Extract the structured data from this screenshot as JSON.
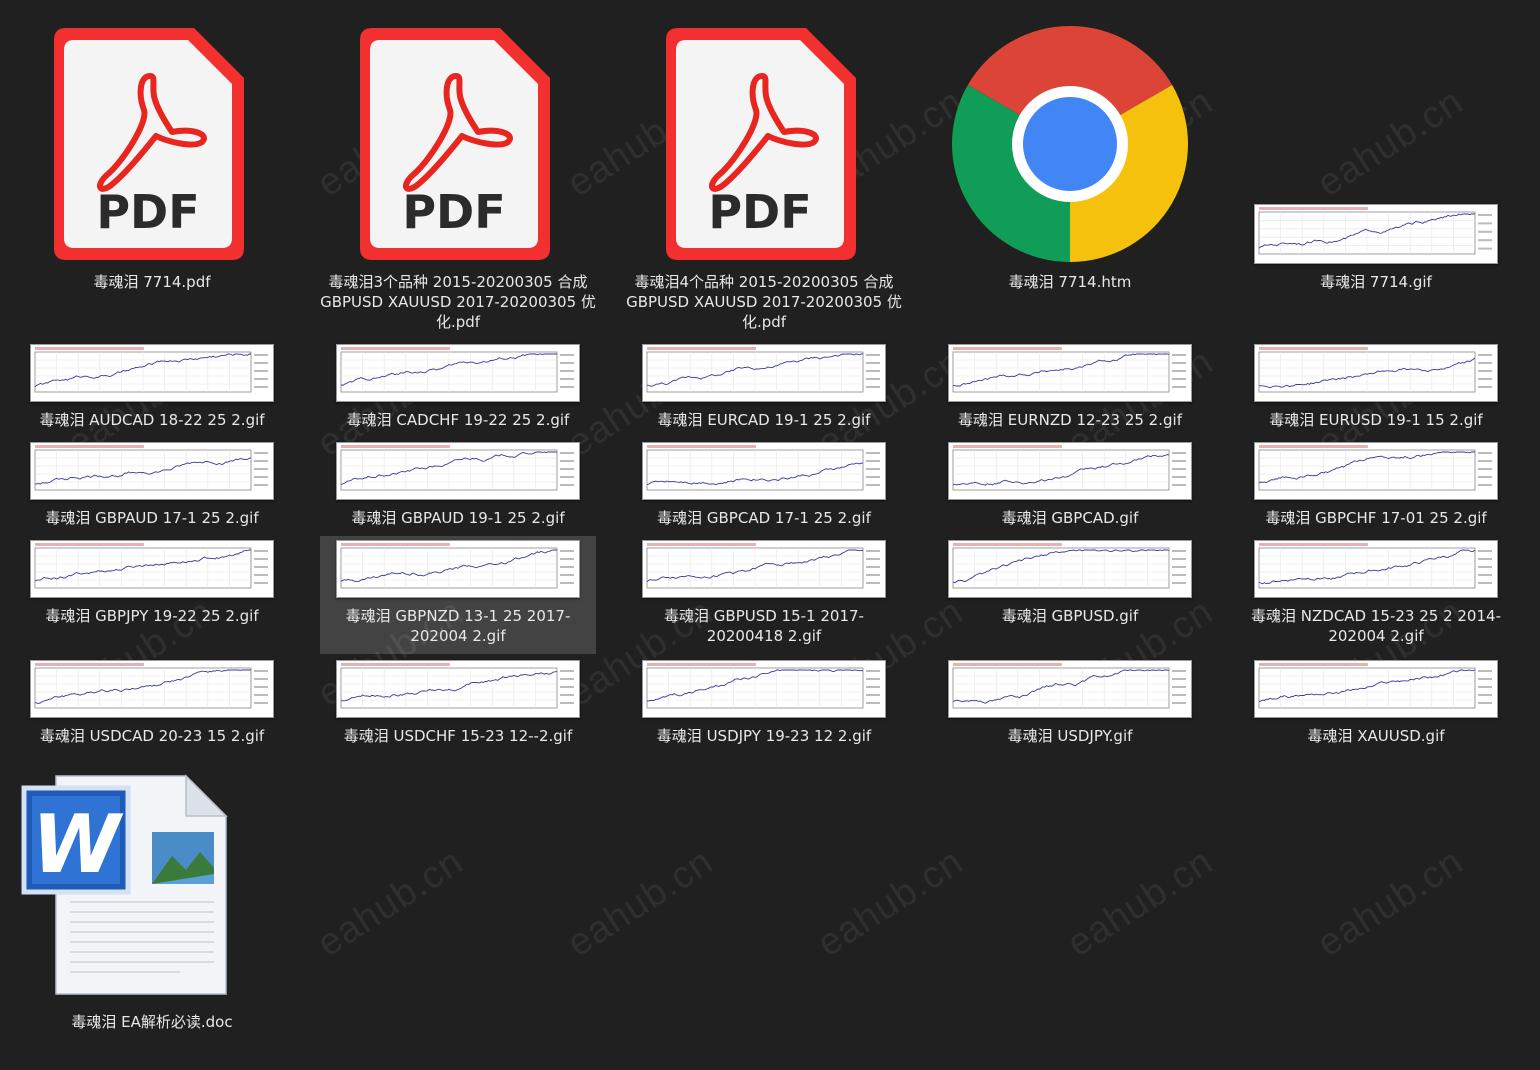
{
  "watermark": "eahub.cn",
  "files": [
    {
      "name": "毒魂泪 7714.pdf",
      "type": "pdf"
    },
    {
      "name": "毒魂泪3个品种 2015-20200305 合成 GBPUSD XAUUSD  2017-20200305 优化.pdf",
      "type": "pdf"
    },
    {
      "name": "毒魂泪4个品种 2015-20200305 合成 GBPUSD XAUUSD  2017-20200305 优化.pdf",
      "type": "pdf"
    },
    {
      "name": "毒魂泪 7714.htm",
      "type": "htm"
    },
    {
      "name": "毒魂泪 7714.gif",
      "type": "gif"
    },
    {
      "name": "毒魂泪 AUDCAD 18-22  25   2.gif",
      "type": "gif"
    },
    {
      "name": "毒魂泪 CADCHF  19-22 25    2.gif",
      "type": "gif"
    },
    {
      "name": "毒魂泪 EURCAD 19-1 25      2.gif",
      "type": "gif"
    },
    {
      "name": "毒魂泪 EURNZD 12-23  25  2.gif",
      "type": "gif"
    },
    {
      "name": "毒魂泪 EURUSD 19-1    15   2.gif",
      "type": "gif"
    },
    {
      "name": "毒魂泪 GBPAUD 17-1 25    2.gif",
      "type": "gif"
    },
    {
      "name": "毒魂泪 GBPAUD 19-1 25    2.gif",
      "type": "gif"
    },
    {
      "name": "毒魂泪 GBPCAD 17-1  25    2.gif",
      "type": "gif"
    },
    {
      "name": "毒魂泪 GBPCAD.gif",
      "type": "gif"
    },
    {
      "name": "毒魂泪 GBPCHF 17-01  25    2.gif",
      "type": "gif"
    },
    {
      "name": "毒魂泪 GBPJPY 19-22   25    2.gif",
      "type": "gif"
    },
    {
      "name": "毒魂泪 GBPNZD 13-1  25 2017-202004  2.gif",
      "type": "gif",
      "selected": true
    },
    {
      "name": "毒魂泪 GBPUSD  15-1 2017-20200418    2.gif",
      "type": "gif"
    },
    {
      "name": "毒魂泪 GBPUSD.gif",
      "type": "gif"
    },
    {
      "name": "毒魂泪 NZDCAD 15-23  25    2 2014-202004    2.gif",
      "type": "gif"
    },
    {
      "name": "毒魂泪 USDCAD 20-23  15    2.gif",
      "type": "gif"
    },
    {
      "name": "毒魂泪 USDCHF 15-23  12--2.gif",
      "type": "gif"
    },
    {
      "name": "毒魂泪 USDJPY 19-23  12    2.gif",
      "type": "gif"
    },
    {
      "name": "毒魂泪 USDJPY.gif",
      "type": "gif"
    },
    {
      "name": "毒魂泪 XAUUSD.gif",
      "type": "gif"
    },
    {
      "name": "毒魂泪 EA解析必读.doc",
      "type": "doc"
    }
  ],
  "icons": {
    "pdf": {
      "text": "PDF",
      "border": "#f23030",
      "glyph": "#e8251e"
    },
    "chrome": {
      "red": "#db4437",
      "yellow": "#f4c20d",
      "green": "#0f9d58",
      "blue": "#4285f4"
    },
    "word": {
      "letter": "W",
      "blue": "#1f5bb8"
    },
    "chart_line": "#3a3a9a"
  }
}
